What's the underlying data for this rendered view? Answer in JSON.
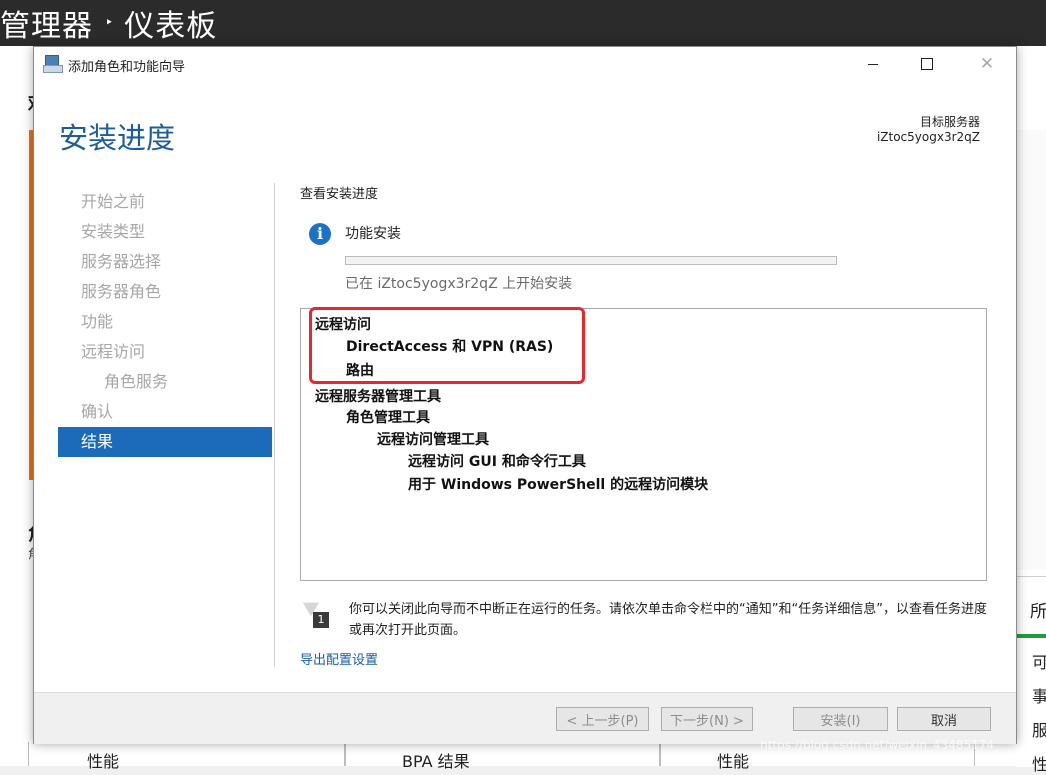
{
  "background": {
    "breadcrumb_app": "管理器",
    "breadcrumb_sep": "‣",
    "breadcrumb_page": "仪表板",
    "left_heading_1": "欢",
    "left_heading_2": "角",
    "left_sub": "角",
    "right_tile": {
      "title": "所",
      "rows": [
        "可",
        "事",
        "服",
        "性"
      ]
    },
    "bottom_tiles": [
      "性能",
      "BPA 结果",
      "性能"
    ]
  },
  "dialog": {
    "title": "添加角色和功能向导",
    "page_title": "安装进度",
    "target_label": "目标服务器",
    "target_name": "iZtoc5yogx3r2qZ",
    "nav": [
      {
        "label": "开始之前",
        "indent": false,
        "active": false
      },
      {
        "label": "安装类型",
        "indent": false,
        "active": false
      },
      {
        "label": "服务器选择",
        "indent": false,
        "active": false
      },
      {
        "label": "服务器角色",
        "indent": false,
        "active": false
      },
      {
        "label": "功能",
        "indent": false,
        "active": false
      },
      {
        "label": "远程访问",
        "indent": false,
        "active": false
      },
      {
        "label": "角色服务",
        "indent": true,
        "active": false
      },
      {
        "label": "确认",
        "indent": false,
        "active": false
      },
      {
        "label": "结果",
        "indent": false,
        "active": true
      }
    ],
    "view_progress_label": "查看安装进度",
    "info_icon_glyph": "i",
    "feature_install_label": "功能安装",
    "progress_value": 0,
    "status_text": "已在 iZtoc5yogx3r2qZ 上开始安装",
    "results": [
      {
        "text": "远程访问",
        "level": 0
      },
      {
        "text": "DirectAccess 和 VPN (RAS)",
        "level": 1
      },
      {
        "text": "路由",
        "level": 1
      },
      {
        "text": "远程服务器管理工具",
        "level": 0
      },
      {
        "text": "角色管理工具",
        "level": 1
      },
      {
        "text": "远程访问管理工具",
        "level": 2
      },
      {
        "text": "远程访问 GUI 和命令行工具",
        "level": 3
      },
      {
        "text": "用于 Windows PowerShell 的远程访问模块",
        "level": 3
      }
    ],
    "note_badge": "1",
    "note_text": "你可以关闭此向导而不中断正在运行的任务。请依次单击命令栏中的“通知”和“任务详细信息”，以查看任务进度或再次打开此页面。",
    "export_link": "导出配置设置",
    "buttons": {
      "prev": "< 上一步(P)",
      "next": "下一步(N) >",
      "install": "安装(I)",
      "cancel": "取消"
    },
    "close_glyph": "✕"
  },
  "watermark": "https://blog.csdn.net/weixin_43485174"
}
